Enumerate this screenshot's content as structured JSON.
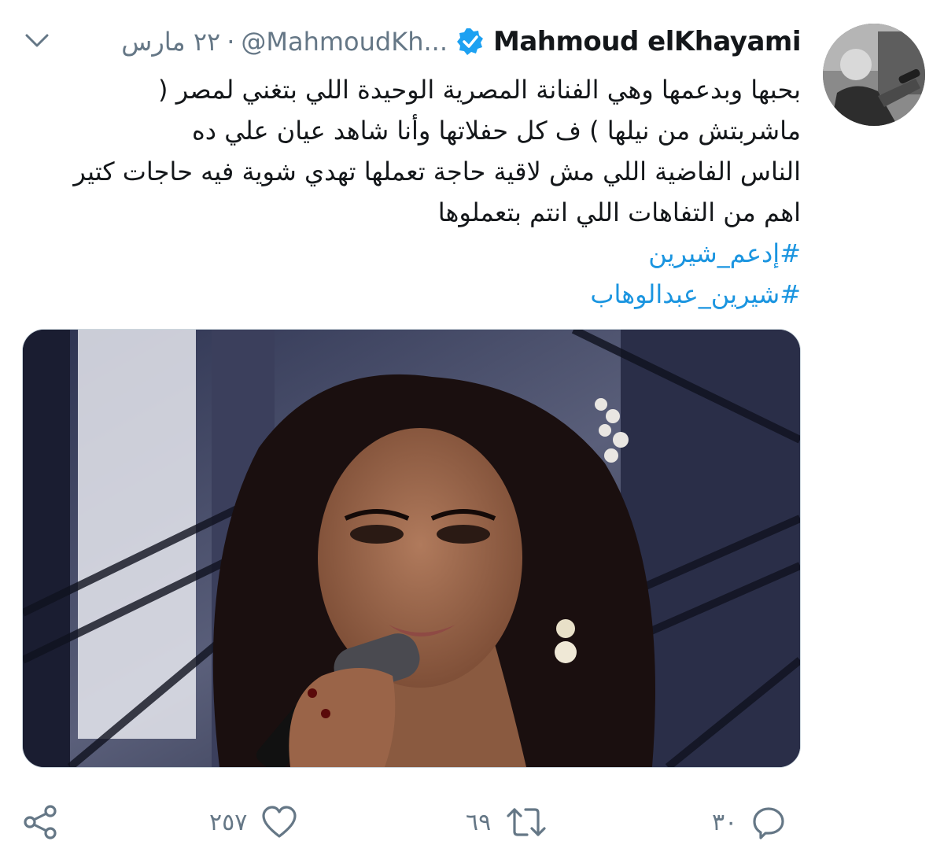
{
  "author": {
    "display_name": "Mahmoud elKhayami",
    "handle": "@MahmoudKh...",
    "separator": "·",
    "date": "٢٢ مارس",
    "verified": true,
    "avatar_icon": "profile-photo"
  },
  "tweet": {
    "lines": [
      "بحبها وبدعمها وهي الفنانة المصرية الوحيدة اللي بتغني لمصر (",
      "ماشربتش من نيلها ) ف كل حفلاتها وأنا شاهد عيان علي ده",
      "الناس الفاضية اللي مش لاقية حاجة تعملها تهدي شوية فيه حاجات كتير",
      "اهم من التفاهات اللي انتم بتعملوها"
    ],
    "hashtags": [
      "#إدعم_شيرين",
      "#شيرين_عبدالوهاب"
    ],
    "media_icon": "photo-of-singer-with-microphone"
  },
  "actions": {
    "reply_count": "٣٠",
    "retweet_count": "٦٩",
    "like_count": "٢٥٧",
    "reply_icon": "reply-icon",
    "retweet_icon": "retweet-icon",
    "like_icon": "heart-icon",
    "share_icon": "share-icon"
  },
  "colors": {
    "link": "#1b95e0",
    "text": "#14171a",
    "muted": "#657786",
    "verified": "#1da1f2"
  }
}
